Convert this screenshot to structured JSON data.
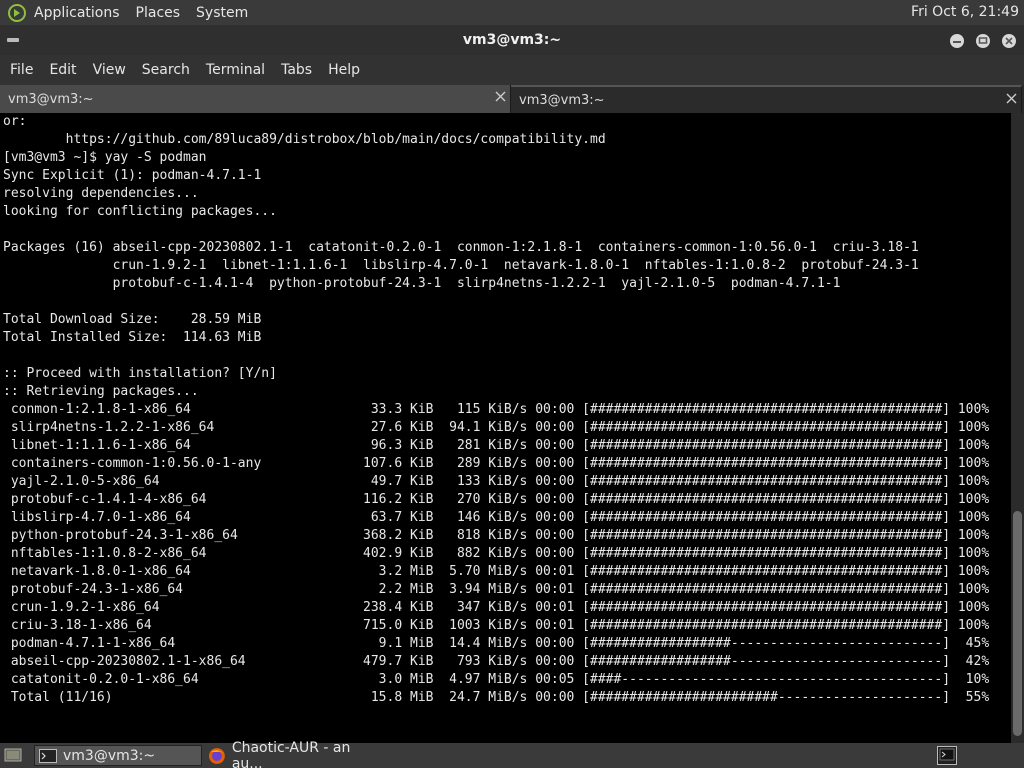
{
  "top_panel": {
    "menus": [
      "Applications",
      "Places",
      "System"
    ],
    "clock": "Fri Oct  6, 21:49"
  },
  "window": {
    "title": "vm3@vm3:~",
    "menu": [
      "File",
      "Edit",
      "View",
      "Search",
      "Terminal",
      "Tabs",
      "Help"
    ],
    "tabs": [
      {
        "label": "vm3@vm3:~"
      },
      {
        "label": "vm3@vm3:~"
      }
    ]
  },
  "terminal": {
    "lines": [
      "or:",
      "        https://github.com/89luca89/distrobox/blob/main/docs/compatibility.md",
      "[vm3@vm3 ~]$ yay -S podman",
      "Sync Explicit (1): podman-4.7.1-1",
      "resolving dependencies...",
      "looking for conflicting packages...",
      "",
      "Packages (16) abseil-cpp-20230802.1-1  catatonit-0.2.0-1  conmon-1:2.1.8-1  containers-common-1:0.56.0-1  criu-3.18-1",
      "              crun-1.9.2-1  libnet-1:1.1.6-1  libslirp-4.7.0-1  netavark-1.8.0-1  nftables-1:1.0.8-2  protobuf-24.3-1",
      "              protobuf-c-1.4.1-4  python-protobuf-24.3-1  slirp4netns-1.2.2-1  yajl-2.1.0-5  podman-4.7.1-1",
      "",
      "Total Download Size:    28.59 MiB",
      "Total Installed Size:  114.63 MiB",
      "",
      ":: Proceed with installation? [Y/n]",
      ":: Retrieving packages...",
      " conmon-1:2.1.8-1-x86_64                       33.3 KiB   115 KiB/s 00:00 [#############################################] 100%",
      " slirp4netns-1.2.2-1-x86_64                    27.6 KiB  94.1 KiB/s 00:00 [#############################################] 100%",
      " libnet-1:1.1.6-1-x86_64                       96.3 KiB   281 KiB/s 00:00 [#############################################] 100%",
      " containers-common-1:0.56.0-1-any             107.6 KiB   289 KiB/s 00:00 [#############################################] 100%",
      " yajl-2.1.0-5-x86_64                           49.7 KiB   133 KiB/s 00:00 [#############################################] 100%",
      " protobuf-c-1.4.1-4-x86_64                    116.2 KiB   270 KiB/s 00:00 [#############################################] 100%",
      " libslirp-4.7.0-1-x86_64                       63.7 KiB   146 KiB/s 00:00 [#############################################] 100%",
      " python-protobuf-24.3-1-x86_64                368.2 KiB   818 KiB/s 00:00 [#############################################] 100%",
      " nftables-1:1.0.8-2-x86_64                    402.9 KiB   882 KiB/s 00:00 [#############################################] 100%",
      " netavark-1.8.0-1-x86_64                        3.2 MiB  5.70 MiB/s 00:01 [#############################################] 100%",
      " protobuf-24.3-1-x86_64                         2.2 MiB  3.94 MiB/s 00:01 [#############################################] 100%",
      " crun-1.9.2-1-x86_64                          238.4 KiB   347 KiB/s 00:01 [#############################################] 100%",
      " criu-3.18-1-x86_64                           715.0 KiB  1003 KiB/s 00:01 [#############################################] 100%",
      " podman-4.7.1-1-x86_64                          9.1 MiB  14.4 MiB/s 00:00 [##################---------------------------]  45%",
      " abseil-cpp-20230802.1-1-x86_64               479.7 KiB   793 KiB/s 00:00 [##################---------------------------]  42%",
      " catatonit-0.2.0-1-x86_64                       3.0 MiB  4.97 MiB/s 00:05 [####-----------------------------------------]  10%",
      " Total (11/16)                                 15.8 MiB  24.7 MiB/s 00:00 [########################---------------------]  55%"
    ]
  },
  "taskbar": {
    "items": [
      {
        "label": "vm3@vm3:~"
      },
      {
        "label": "Chaotic-AUR - an au..."
      }
    ]
  },
  "icons": {
    "distro_logo": "distro-logo-icon",
    "window_menu": "window-menu-icon",
    "minimize": "minimize-icon",
    "maximize": "maximize-icon",
    "close": "close-icon",
    "tab_close": "tab-close-icon",
    "show_desktop": "show-desktop-icon",
    "terminal": "terminal-icon",
    "firefox": "firefox-icon"
  }
}
